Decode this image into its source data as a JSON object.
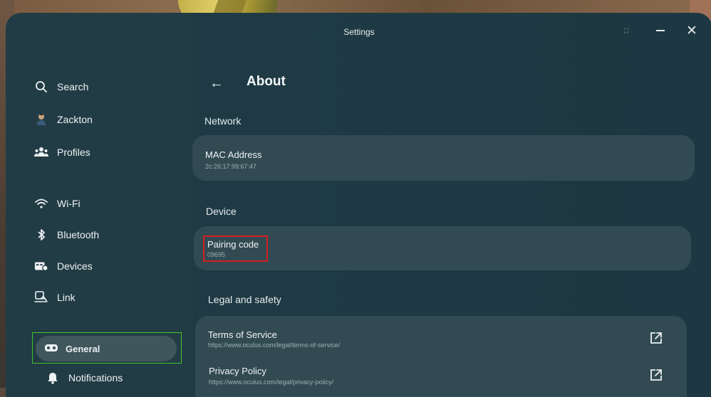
{
  "window": {
    "title": "Settings"
  },
  "sidebar": {
    "items": [
      {
        "label": "Search",
        "icon": "search-icon"
      },
      {
        "label": "Zackton",
        "icon": "user-avatar-icon"
      },
      {
        "label": "Profiles",
        "icon": "people-icon"
      },
      {
        "label": "Wi-Fi",
        "icon": "wifi-icon"
      },
      {
        "label": "Bluetooth",
        "icon": "bluetooth-icon"
      },
      {
        "label": "Devices",
        "icon": "devices-icon"
      },
      {
        "label": "Link",
        "icon": "link-icon"
      },
      {
        "label": "General",
        "icon": "headset-icon",
        "selected": true
      },
      {
        "label": "Notifications",
        "icon": "bell-icon"
      }
    ]
  },
  "page": {
    "title": "About",
    "sections": {
      "network": "Network",
      "device": "Device",
      "legal": "Legal and safety"
    },
    "network_rows": [
      {
        "title": "MAC Address",
        "value": "2c:26:17:99:67:47"
      }
    ],
    "device_rows": [
      {
        "title": "Pairing code",
        "value": "09695"
      }
    ],
    "legal_rows": [
      {
        "title": "Terms of Service",
        "value": "https://www.oculus.com/legal/terms-of-service/"
      },
      {
        "title": "Privacy Policy",
        "value": "https://www.oculus.com/legal/privacy-policy/"
      }
    ]
  },
  "colors": {
    "highlight_red": "#d11f1f",
    "highlight_green": "#43c425",
    "panel": "#223c45",
    "card": "#324a52"
  }
}
